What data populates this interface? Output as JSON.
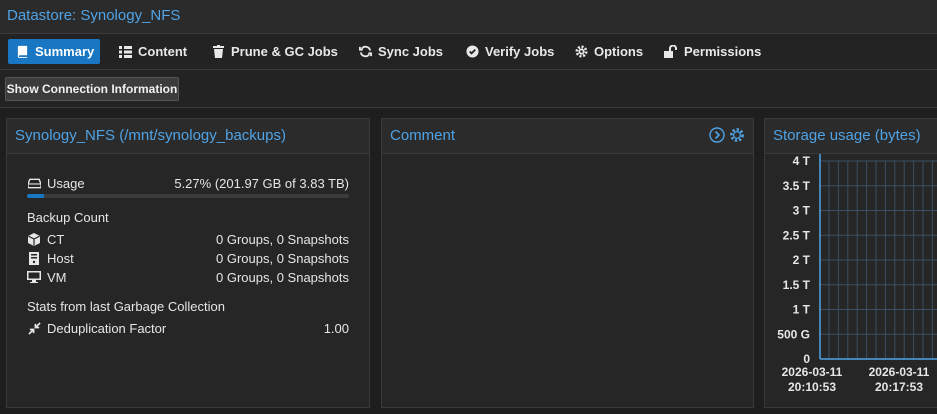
{
  "window": {
    "title": "Datastore: Synology_NFS"
  },
  "tabs": [
    {
      "label": "Summary",
      "icon": "book-icon",
      "active": true
    },
    {
      "label": "Content",
      "icon": "grid-icon"
    },
    {
      "label": "Prune & GC Jobs",
      "icon": "trash-icon"
    },
    {
      "label": "Sync Jobs",
      "icon": "refresh-icon"
    },
    {
      "label": "Verify Jobs",
      "icon": "check-circle-icon"
    },
    {
      "label": "Options",
      "icon": "gear-icon"
    },
    {
      "label": "Permissions",
      "icon": "unlock-icon"
    }
  ],
  "toolbar": {
    "connection_button": "Show Connection Information"
  },
  "summary_panel": {
    "title": "Synology_NFS (/mnt/synology_backups)",
    "usage": {
      "label": "Usage",
      "value": "5.27% (201.97 GB of 3.83 TB)",
      "fraction": 0.0527
    },
    "backup_count": {
      "heading": "Backup Count",
      "items": [
        {
          "label": "CT",
          "value": "0 Groups, 0 Snapshots",
          "icon": "cube-icon"
        },
        {
          "label": "Host",
          "value": "0 Groups, 0 Snapshots",
          "icon": "server-icon"
        },
        {
          "label": "VM",
          "value": "0 Groups, 0 Snapshots",
          "icon": "monitor-icon"
        }
      ]
    },
    "gc": {
      "heading": "Stats from last Garbage Collection",
      "dedup_label": "Deduplication Factor",
      "dedup_value": "1.00"
    }
  },
  "comment_panel": {
    "title": "Comment"
  },
  "storage_panel": {
    "title": "Storage usage (bytes)"
  },
  "chart_data": {
    "type": "area",
    "title": "Storage usage (bytes)",
    "y_ticks": [
      "0",
      "500 G",
      "1 T",
      "1.5 T",
      "2 T",
      "2.5 T",
      "3 T",
      "3.5 T",
      "4 T"
    ],
    "ylim": [
      0,
      4
    ],
    "x_ticks": [
      {
        "date": "2026-03-11",
        "time": "20:10:53"
      },
      {
        "date": "2026-03-11",
        "time": "20:17:53"
      }
    ],
    "grid": true,
    "series": [],
    "colors": {
      "grid": "#3a4f63",
      "axis": "#4fa3e6"
    }
  },
  "colors": {
    "accent": "#1976c2",
    "link": "#4fa3e6",
    "background": "#1e1e1e"
  }
}
